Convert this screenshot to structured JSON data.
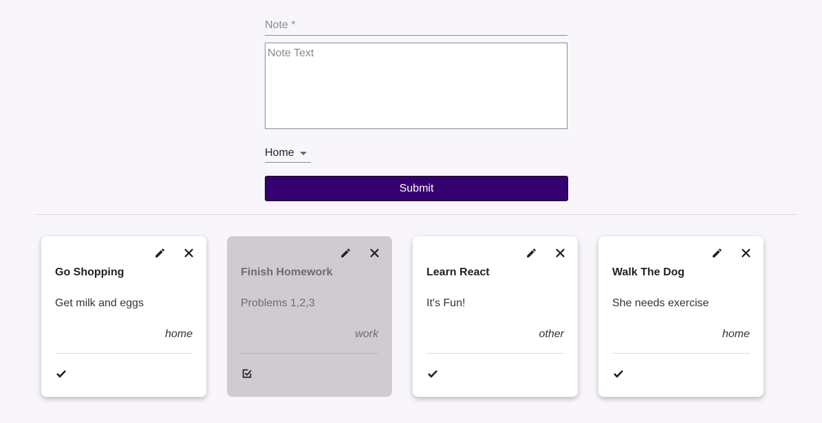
{
  "form": {
    "note_label": "Note *",
    "note_value": "",
    "text_placeholder": "Note Text",
    "category_selected": "Home",
    "submit_label": "Submit"
  },
  "colors": {
    "accent": "#350070",
    "background": "#f9f6fb",
    "done_card": "#d0cbd0"
  },
  "notes": [
    {
      "title": "Go Shopping",
      "body": "Get milk and eggs",
      "category": "home",
      "completed": false
    },
    {
      "title": "Finish Homework",
      "body": "Problems 1,2,3",
      "category": "work",
      "completed": true
    },
    {
      "title": "Learn React",
      "body": "It's Fun!",
      "category": "other",
      "completed": false
    },
    {
      "title": "Walk The Dog",
      "body": "She needs exercise",
      "category": "home",
      "completed": false
    }
  ]
}
